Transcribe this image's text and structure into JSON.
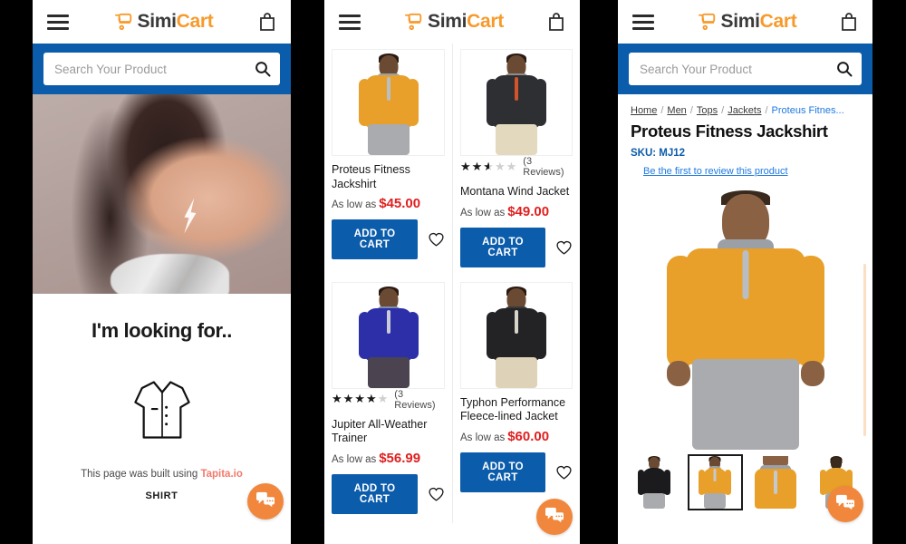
{
  "header": {
    "menu_icon": "hamburger-menu-icon",
    "logo_first": "Simi",
    "logo_second": "Cart",
    "cart_icon": "shopping-bag-icon"
  },
  "search": {
    "placeholder": "Search Your Product",
    "value": "",
    "icon": "search-icon"
  },
  "colors": {
    "brand_blue": "#0b5cab",
    "brand_orange": "#f79a2b",
    "price_red": "#e02020",
    "link_blue": "#1f7ae0",
    "tapita_pink": "#f2796a",
    "chat_orange": "#f0873c"
  },
  "panel1": {
    "hero_alt": "woman-portrait-with-lightning-bolt-face-paint",
    "heading": "I'm looking for..",
    "category_icon": "shirt-icon",
    "built_prefix": "This page was built using ",
    "built_brand": "Tapita.io",
    "category_label": "SHIRT"
  },
  "panel2": {
    "add_to_cart_label": "ADD TO CART",
    "as_low_as_label": "As low as",
    "wishlist_icon": "heart-icon",
    "products": [
      {
        "name": "Proteus Fitness Jackshirt",
        "price": "$45.00",
        "rating": null,
        "reviews": null,
        "image": "man-in-orange-quarter-zip-pullover"
      },
      {
        "name": "Montana Wind Jacket",
        "price": "$49.00",
        "rating": 2.5,
        "reviews": "(3 Reviews)",
        "image": "man-in-black-puffer-jacket"
      },
      {
        "name": "Jupiter All-Weather Trainer",
        "price": "$56.99",
        "rating": 4,
        "reviews": "(3 Reviews)",
        "image": "man-in-blue-zip-hoodie"
      },
      {
        "name": "Typhon Performance Fleece-lined Jacket",
        "price": "$60.00",
        "rating": null,
        "reviews": null,
        "image": "man-in-black-bomber-jacket"
      }
    ]
  },
  "panel3": {
    "breadcrumb": [
      "Home",
      "Men",
      "Tops",
      "Jackets"
    ],
    "breadcrumb_current": "Proteus Fitnes...",
    "title": "Proteus Fitness Jackshirt",
    "sku": "SKU: MJ12",
    "review_link": "Be the first to review this product",
    "main_image": "man-in-orange-quarter-zip-pullover",
    "thumbnails": [
      {
        "alt": "black-long-sleeve-variant",
        "selected": false
      },
      {
        "alt": "orange-quarter-zip-front",
        "selected": true
      },
      {
        "alt": "orange-collar-closeup",
        "selected": false
      },
      {
        "alt": "orange-quarter-zip-back",
        "selected": false
      }
    ]
  },
  "chat": {
    "icon": "chat-bubbles-icon",
    "label": "Chat"
  }
}
